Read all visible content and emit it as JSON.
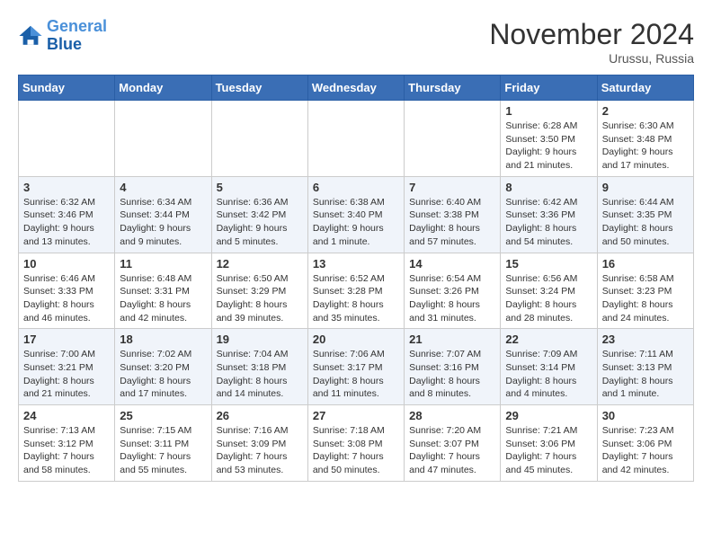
{
  "header": {
    "logo_line1": "General",
    "logo_line2": "Blue",
    "month": "November 2024",
    "location": "Urussu, Russia"
  },
  "days_of_week": [
    "Sunday",
    "Monday",
    "Tuesday",
    "Wednesday",
    "Thursday",
    "Friday",
    "Saturday"
  ],
  "weeks": [
    [
      {
        "day": "",
        "info": ""
      },
      {
        "day": "",
        "info": ""
      },
      {
        "day": "",
        "info": ""
      },
      {
        "day": "",
        "info": ""
      },
      {
        "day": "",
        "info": ""
      },
      {
        "day": "1",
        "info": "Sunrise: 6:28 AM\nSunset: 3:50 PM\nDaylight: 9 hours and 21 minutes."
      },
      {
        "day": "2",
        "info": "Sunrise: 6:30 AM\nSunset: 3:48 PM\nDaylight: 9 hours and 17 minutes."
      }
    ],
    [
      {
        "day": "3",
        "info": "Sunrise: 6:32 AM\nSunset: 3:46 PM\nDaylight: 9 hours and 13 minutes."
      },
      {
        "day": "4",
        "info": "Sunrise: 6:34 AM\nSunset: 3:44 PM\nDaylight: 9 hours and 9 minutes."
      },
      {
        "day": "5",
        "info": "Sunrise: 6:36 AM\nSunset: 3:42 PM\nDaylight: 9 hours and 5 minutes."
      },
      {
        "day": "6",
        "info": "Sunrise: 6:38 AM\nSunset: 3:40 PM\nDaylight: 9 hours and 1 minute."
      },
      {
        "day": "7",
        "info": "Sunrise: 6:40 AM\nSunset: 3:38 PM\nDaylight: 8 hours and 57 minutes."
      },
      {
        "day": "8",
        "info": "Sunrise: 6:42 AM\nSunset: 3:36 PM\nDaylight: 8 hours and 54 minutes."
      },
      {
        "day": "9",
        "info": "Sunrise: 6:44 AM\nSunset: 3:35 PM\nDaylight: 8 hours and 50 minutes."
      }
    ],
    [
      {
        "day": "10",
        "info": "Sunrise: 6:46 AM\nSunset: 3:33 PM\nDaylight: 8 hours and 46 minutes."
      },
      {
        "day": "11",
        "info": "Sunrise: 6:48 AM\nSunset: 3:31 PM\nDaylight: 8 hours and 42 minutes."
      },
      {
        "day": "12",
        "info": "Sunrise: 6:50 AM\nSunset: 3:29 PM\nDaylight: 8 hours and 39 minutes."
      },
      {
        "day": "13",
        "info": "Sunrise: 6:52 AM\nSunset: 3:28 PM\nDaylight: 8 hours and 35 minutes."
      },
      {
        "day": "14",
        "info": "Sunrise: 6:54 AM\nSunset: 3:26 PM\nDaylight: 8 hours and 31 minutes."
      },
      {
        "day": "15",
        "info": "Sunrise: 6:56 AM\nSunset: 3:24 PM\nDaylight: 8 hours and 28 minutes."
      },
      {
        "day": "16",
        "info": "Sunrise: 6:58 AM\nSunset: 3:23 PM\nDaylight: 8 hours and 24 minutes."
      }
    ],
    [
      {
        "day": "17",
        "info": "Sunrise: 7:00 AM\nSunset: 3:21 PM\nDaylight: 8 hours and 21 minutes."
      },
      {
        "day": "18",
        "info": "Sunrise: 7:02 AM\nSunset: 3:20 PM\nDaylight: 8 hours and 17 minutes."
      },
      {
        "day": "19",
        "info": "Sunrise: 7:04 AM\nSunset: 3:18 PM\nDaylight: 8 hours and 14 minutes."
      },
      {
        "day": "20",
        "info": "Sunrise: 7:06 AM\nSunset: 3:17 PM\nDaylight: 8 hours and 11 minutes."
      },
      {
        "day": "21",
        "info": "Sunrise: 7:07 AM\nSunset: 3:16 PM\nDaylight: 8 hours and 8 minutes."
      },
      {
        "day": "22",
        "info": "Sunrise: 7:09 AM\nSunset: 3:14 PM\nDaylight: 8 hours and 4 minutes."
      },
      {
        "day": "23",
        "info": "Sunrise: 7:11 AM\nSunset: 3:13 PM\nDaylight: 8 hours and 1 minute."
      }
    ],
    [
      {
        "day": "24",
        "info": "Sunrise: 7:13 AM\nSunset: 3:12 PM\nDaylight: 7 hours and 58 minutes."
      },
      {
        "day": "25",
        "info": "Sunrise: 7:15 AM\nSunset: 3:11 PM\nDaylight: 7 hours and 55 minutes."
      },
      {
        "day": "26",
        "info": "Sunrise: 7:16 AM\nSunset: 3:09 PM\nDaylight: 7 hours and 53 minutes."
      },
      {
        "day": "27",
        "info": "Sunrise: 7:18 AM\nSunset: 3:08 PM\nDaylight: 7 hours and 50 minutes."
      },
      {
        "day": "28",
        "info": "Sunrise: 7:20 AM\nSunset: 3:07 PM\nDaylight: 7 hours and 47 minutes."
      },
      {
        "day": "29",
        "info": "Sunrise: 7:21 AM\nSunset: 3:06 PM\nDaylight: 7 hours and 45 minutes."
      },
      {
        "day": "30",
        "info": "Sunrise: 7:23 AM\nSunset: 3:06 PM\nDaylight: 7 hours and 42 minutes."
      }
    ]
  ]
}
